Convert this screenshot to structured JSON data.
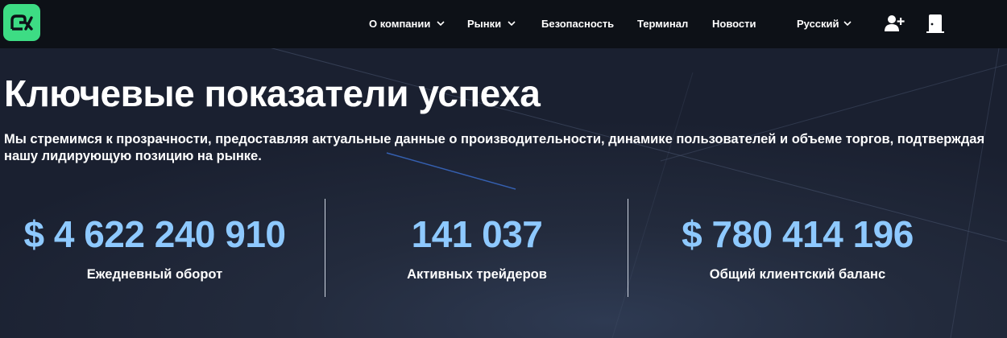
{
  "header": {
    "logo_icon": "brand-logo-icon",
    "nav": [
      {
        "label": "О компании",
        "dropdown": true
      },
      {
        "label": "Рынки",
        "dropdown": true
      },
      {
        "label": "Безопасность",
        "dropdown": false
      },
      {
        "label": "Терминал",
        "dropdown": false
      },
      {
        "label": "Новости",
        "dropdown": false
      }
    ],
    "language": "Русский",
    "register_icon": "add-user-icon",
    "login_icon": "door-icon"
  },
  "hero": {
    "title": "Ключевые показатели успеха",
    "subtitle": "Мы стремимся к прозрачности, предоставляя актуальные данные о производительности, динамике пользователей и объеме торгов, подтверждая нашу лидирующую позицию на рынке."
  },
  "stats": [
    {
      "value": "$ 4 622 240 910",
      "label": "Ежедневный оборот"
    },
    {
      "value": "141 037",
      "label": "Активных трейдеров"
    },
    {
      "value": "$ 780 414 196",
      "label": "Общий клиентский баланс"
    }
  ],
  "colors": {
    "accent_green": "#3ddc84",
    "stat_blue": "#8ec9ff",
    "header_bg": "#0d1117"
  }
}
